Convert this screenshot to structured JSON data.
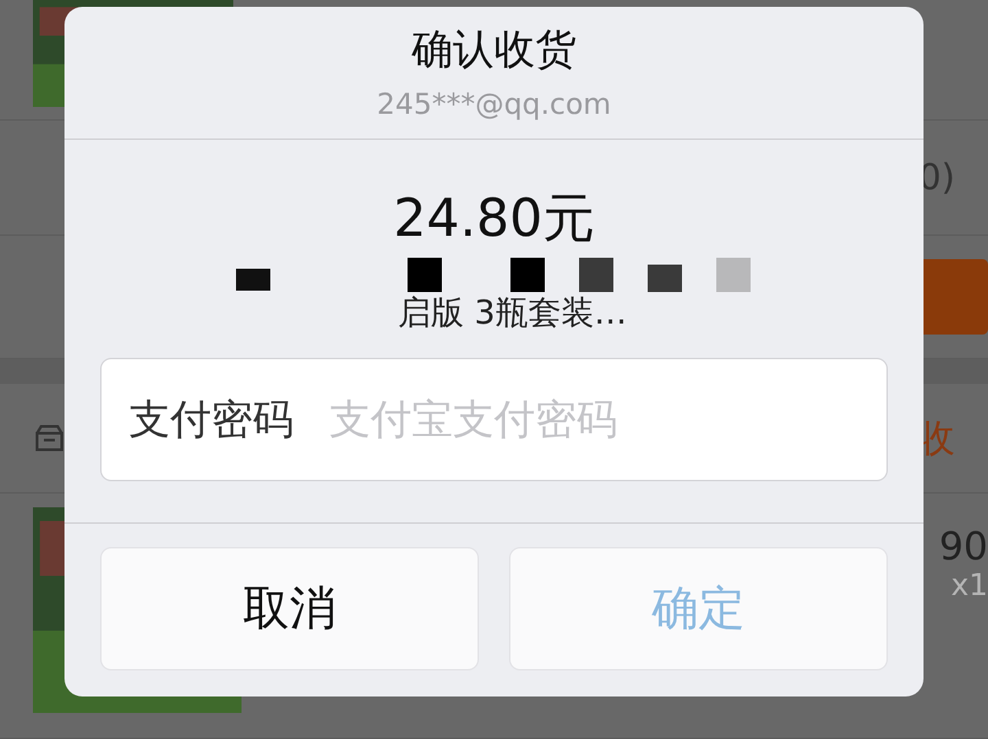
{
  "background": {
    "count_text": "0)",
    "status_text": "收",
    "price": "90",
    "quantity": "x1"
  },
  "dialog": {
    "title": "确认收货",
    "account": "245***@qq.com",
    "amount": "24.80元",
    "product_name": "启版 3瓶套装…",
    "password_field": {
      "label": "支付密码",
      "placeholder": "支付宝支付密码"
    },
    "buttons": [
      {
        "label": "取消",
        "kind": "cancel"
      },
      {
        "label": "确定",
        "kind": "confirm"
      }
    ]
  }
}
